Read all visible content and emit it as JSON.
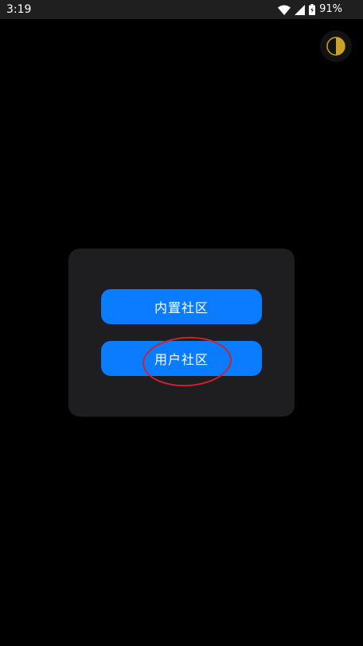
{
  "status_bar": {
    "time": "3:19",
    "battery_percent": "91%",
    "icons": [
      "wifi-icon",
      "cell-signal-icon",
      "battery-icon"
    ]
  },
  "theme_toggle": {
    "icon": "half-moon-contrast-icon",
    "color": "#c9a227"
  },
  "dialog": {
    "buttons": {
      "builtin_community": "内置社区",
      "user_community": "用户社区"
    },
    "button_color": "#0a7cff"
  },
  "annotation": {
    "color": "#d0202a",
    "target": "user_community"
  }
}
